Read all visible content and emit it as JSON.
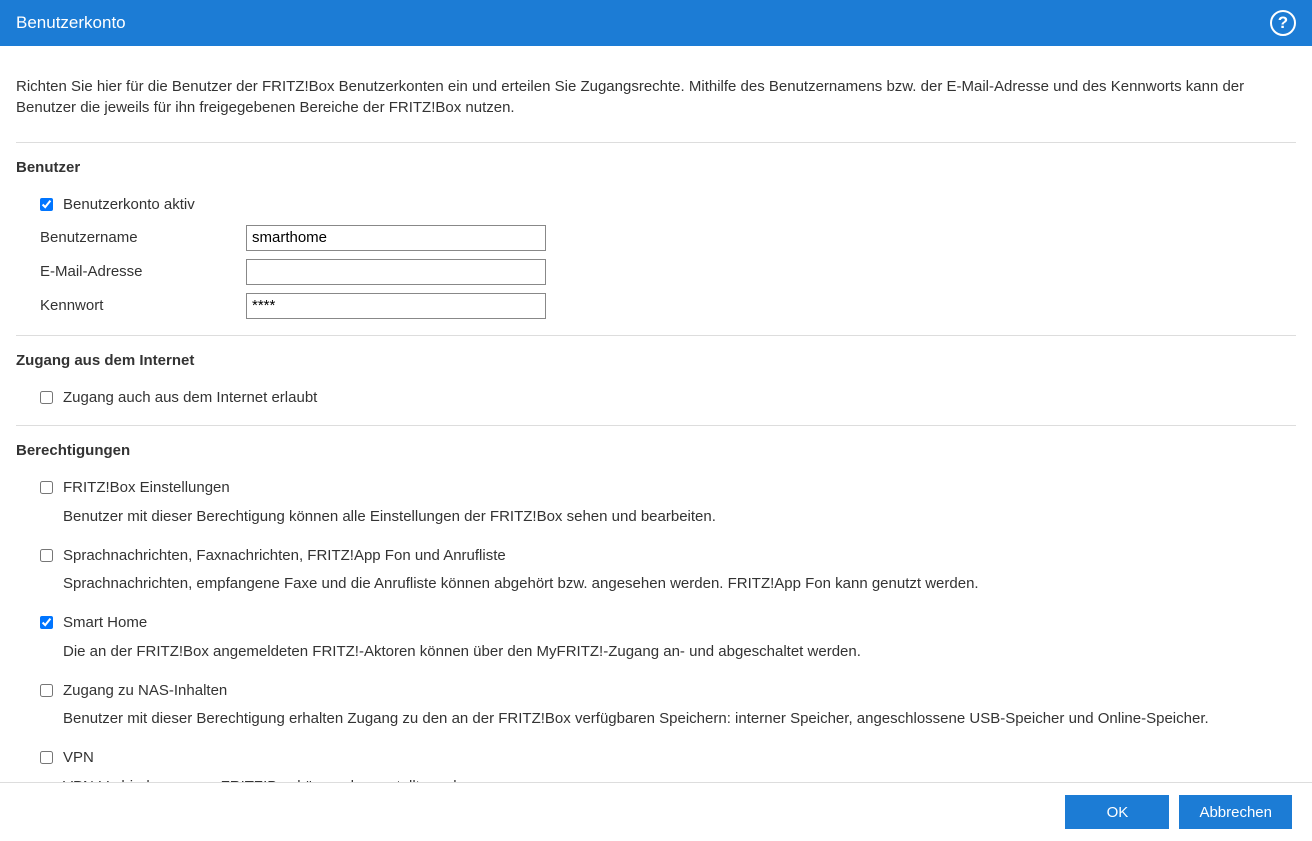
{
  "header": {
    "title": "Benutzerkonto"
  },
  "intro": "Richten Sie hier für die Benutzer der FRITZ!Box Benutzerkonten ein und erteilen Sie Zugangsrechte. Mithilfe des Benutzernamens bzw. der E-Mail-Adresse und des Kennworts kann der Benutzer die jeweils für ihn freigegebenen Bereiche der FRITZ!Box nutzen.",
  "sections": {
    "user": {
      "title": "Benutzer",
      "active": {
        "label": "Benutzerkonto aktiv",
        "checked": true
      },
      "username": {
        "label": "Benutzername",
        "value": "smarthome"
      },
      "email": {
        "label": "E-Mail-Adresse",
        "value": ""
      },
      "password": {
        "label": "Kennwort",
        "value": "****"
      }
    },
    "internet": {
      "title": "Zugang aus dem Internet",
      "allow": {
        "label": "Zugang auch aus dem Internet erlaubt",
        "checked": false
      }
    },
    "permissions": {
      "title": "Berechtigungen",
      "items": [
        {
          "label": "FRITZ!Box Einstellungen",
          "desc": "Benutzer mit dieser Berechtigung können alle Einstellungen der FRITZ!Box sehen und bearbeiten.",
          "checked": false
        },
        {
          "label": "Sprachnachrichten, Faxnachrichten, FRITZ!App Fon und Anrufliste",
          "desc": "Sprachnachrichten, empfangene Faxe und die Anrufliste können abgehört bzw. angesehen werden. FRITZ!App Fon kann genutzt werden.",
          "checked": false
        },
        {
          "label": "Smart Home",
          "desc": "Die an der FRITZ!Box angemeldeten FRITZ!-Aktoren können über den MyFRITZ!-Zugang an- und abgeschaltet werden.",
          "checked": true
        },
        {
          "label": "Zugang zu NAS-Inhalten",
          "desc": "Benutzer mit dieser Berechtigung erhalten Zugang zu den an der FRITZ!Box verfügbaren Speichern: interner Speicher, angeschlossene USB-Speicher und Online-Speicher.",
          "checked": false
        },
        {
          "label": "VPN",
          "desc": "VPN-Verbindungen zur FRITZ!Box können hergestellt werden.",
          "checked": false
        }
      ]
    }
  },
  "footer": {
    "ok": "OK",
    "cancel": "Abbrechen"
  },
  "colors": {
    "brand": "#1c7cd5"
  }
}
